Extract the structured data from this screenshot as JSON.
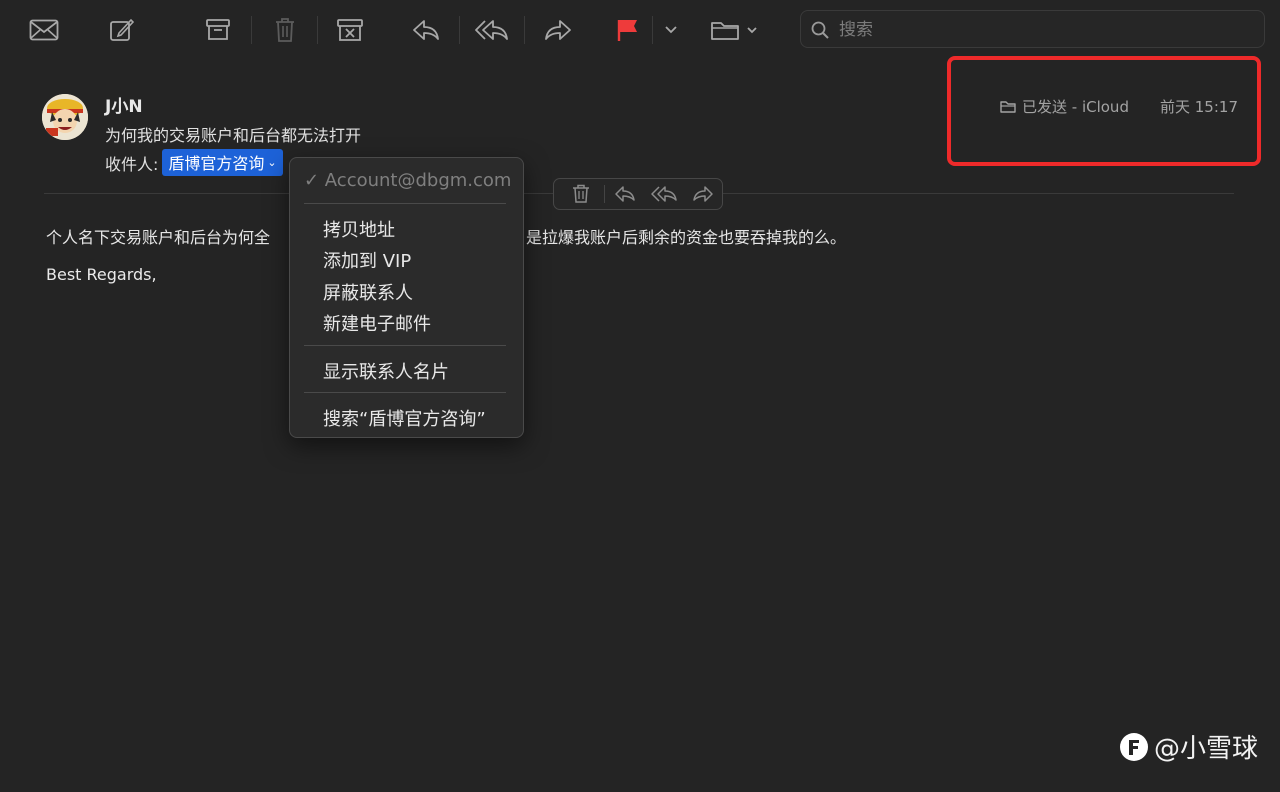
{
  "toolbar": {
    "icons": [
      "envelope-icon",
      "compose-icon",
      "archive-icon",
      "trash-icon",
      "junk-icon",
      "reply-icon",
      "reply-all-icon",
      "forward-icon",
      "flag-icon",
      "folder-icon"
    ],
    "flag_color": "#ee3b3b"
  },
  "search": {
    "placeholder": "搜索"
  },
  "message": {
    "sender": "J小N",
    "subject": "为何我的交易账户和后台都无法打开",
    "to_label": "收件人:",
    "recipient": "盾博官方咨询",
    "mailbox": "已发送 - iCloud",
    "time": "前天 15:17",
    "body_line1_a": "个人名下交易账户和后台为何全",
    "body_line1_b": "是拉爆我账户后剩余的资金也要吞掉我的么。",
    "regards": "Best Regards,"
  },
  "context_menu": {
    "account": "✓ Account@dbgm.com",
    "copy_address": "拷贝地址",
    "add_vip": "添加到 VIP",
    "block": "屏蔽联系人",
    "new_email": "新建电子邮件",
    "show_card": "显示联系人名片",
    "search": "搜索“盾博官方咨询”"
  },
  "watermark": {
    "text": "@小雪球"
  },
  "colors": {
    "accent": "#1d62d8",
    "highlight": "#ee2a2a",
    "background": "#242424"
  }
}
